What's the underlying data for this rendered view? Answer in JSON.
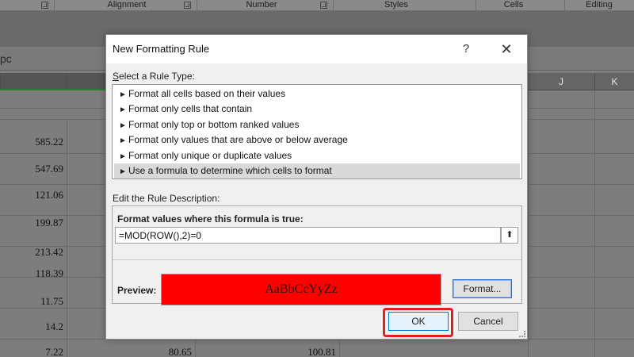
{
  "ribbon": {
    "groups": [
      "Alignment",
      "Number",
      "Styles",
      "Cells",
      "Editing"
    ]
  },
  "name_box_partial": "pc",
  "columns": [
    "J",
    "K"
  ],
  "grid": {
    "col_b_values": [
      "585.22",
      "547.69",
      "121.06",
      "199.87",
      "213.42",
      "118.39",
      "11.75",
      "14.2",
      "7.22"
    ],
    "bottom_row": [
      "80.65",
      "100.81"
    ]
  },
  "dialog": {
    "title": "New Formatting Rule",
    "help_glyph": "?",
    "close_glyph": "✕",
    "rule_type_label": "Select a Rule Type:",
    "rule_types": [
      "Format all cells based on their values",
      "Format only cells that contain",
      "Format only top or bottom ranked values",
      "Format only values that are above or below average",
      "Format only unique or duplicate values",
      "Use a formula to determine which cells to format"
    ],
    "selected_rule_index": 5,
    "edit_label": "Edit the Rule Description:",
    "formula_label": "Format values where this formula is true:",
    "formula_value": "=MOD(ROW(),2)=0",
    "preview_label": "Preview:",
    "preview_text": "AaBbCcYyZz",
    "preview_fill": "#ff0000",
    "format_button": "Format...",
    "ok_button": "OK",
    "cancel_button": "Cancel"
  },
  "colors": {
    "highlight": "#e02020",
    "accent": "#0078d7"
  }
}
